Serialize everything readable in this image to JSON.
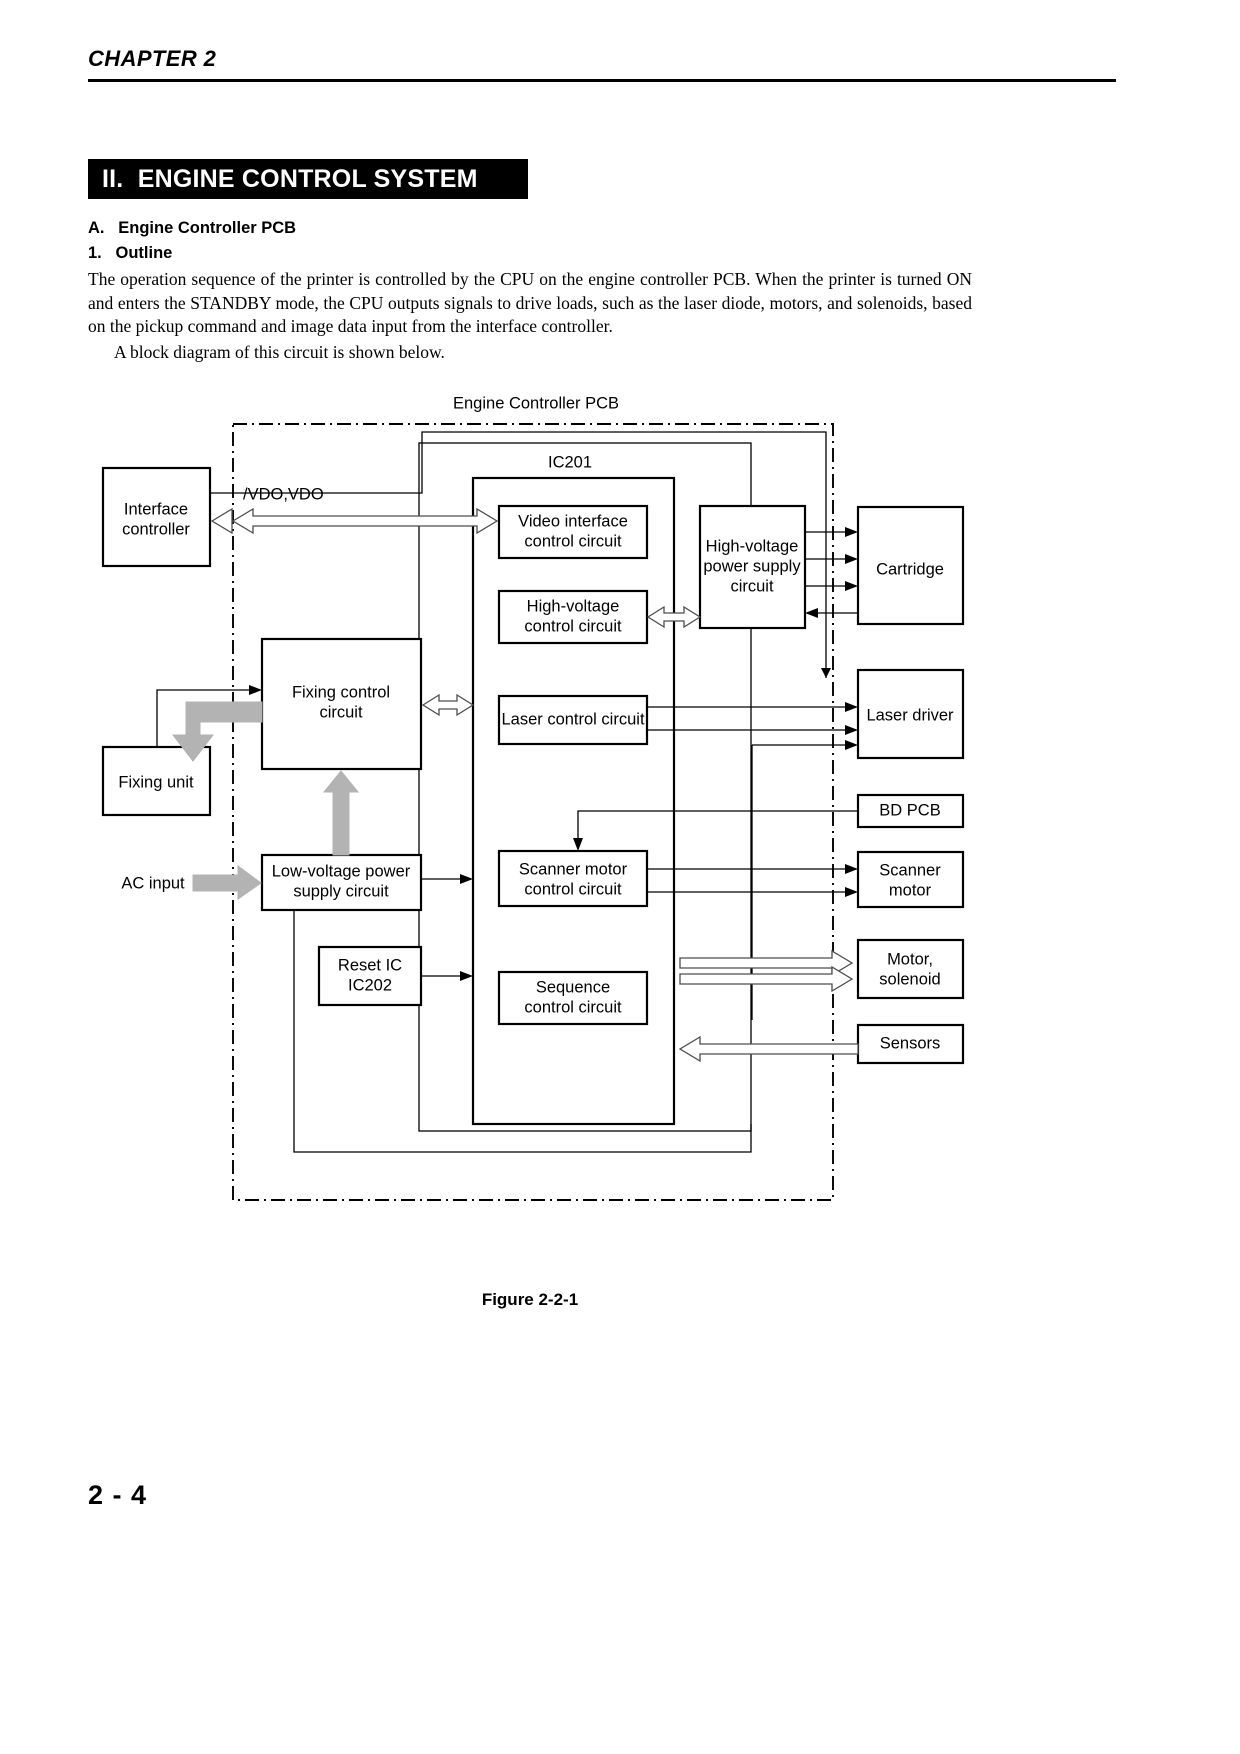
{
  "header": {
    "chapter": "CHAPTER 2"
  },
  "section": {
    "banner": "II.  ENGINE CONTROL SYSTEM"
  },
  "headings": {
    "part_a": "A.   Engine Controller PCB",
    "item_1": "1.   Outline"
  },
  "body": {
    "paragraph_1": "The operation sequence of the printer is controlled by the CPU on the engine controller PCB.  When the printer is turned ON and enters the STANDBY mode, the CPU outputs signals to drive loads, such as the laser diode, motors, and solenoids, based on the pickup command and image data input from the interface controller.",
    "paragraph_2": "A block diagram of this circuit is shown below."
  },
  "diagram": {
    "pcb_title": "Engine Controller PCB",
    "ic_title": "IC201",
    "signal_label": "/VDO,VDO",
    "ac_input_label": "AC input",
    "blocks": {
      "interface_controller": {
        "line1": "Interface",
        "line2": "controller"
      },
      "video_interface": {
        "line1": "Video interface",
        "line2": "control circuit"
      },
      "high_voltage_control": {
        "line1": "High-voltage",
        "line2": "control circuit"
      },
      "high_voltage_psu": {
        "line1": "High-voltage",
        "line2": "power supply",
        "line3": "circuit"
      },
      "cartridge": {
        "line1": "Cartridge"
      },
      "fixing_control": {
        "line1": "Fixing control",
        "line2": "circuit"
      },
      "fixing_unit": {
        "line1": "Fixing unit"
      },
      "laser_control": {
        "line1": "Laser control circuit"
      },
      "laser_driver": {
        "line1": "Laser driver"
      },
      "bd_pcb": {
        "line1": "BD PCB"
      },
      "low_voltage_psu": {
        "line1": "Low-voltage power",
        "line2": "supply circuit"
      },
      "scanner_motor_control": {
        "line1": "Scanner motor",
        "line2": "control circuit"
      },
      "scanner_motor": {
        "line1": "Scanner",
        "line2": "motor"
      },
      "reset_ic": {
        "line1": "Reset IC",
        "line2": "IC202"
      },
      "sequence_control": {
        "line1": "Sequence",
        "line2": "control circuit"
      },
      "motor_solenoid": {
        "line1": "Motor,",
        "line2": "solenoid"
      },
      "sensors": {
        "line1": "Sensors"
      }
    }
  },
  "figure": {
    "caption": "Figure 2-2-1"
  },
  "footer": {
    "page_number": "2 - 4"
  }
}
